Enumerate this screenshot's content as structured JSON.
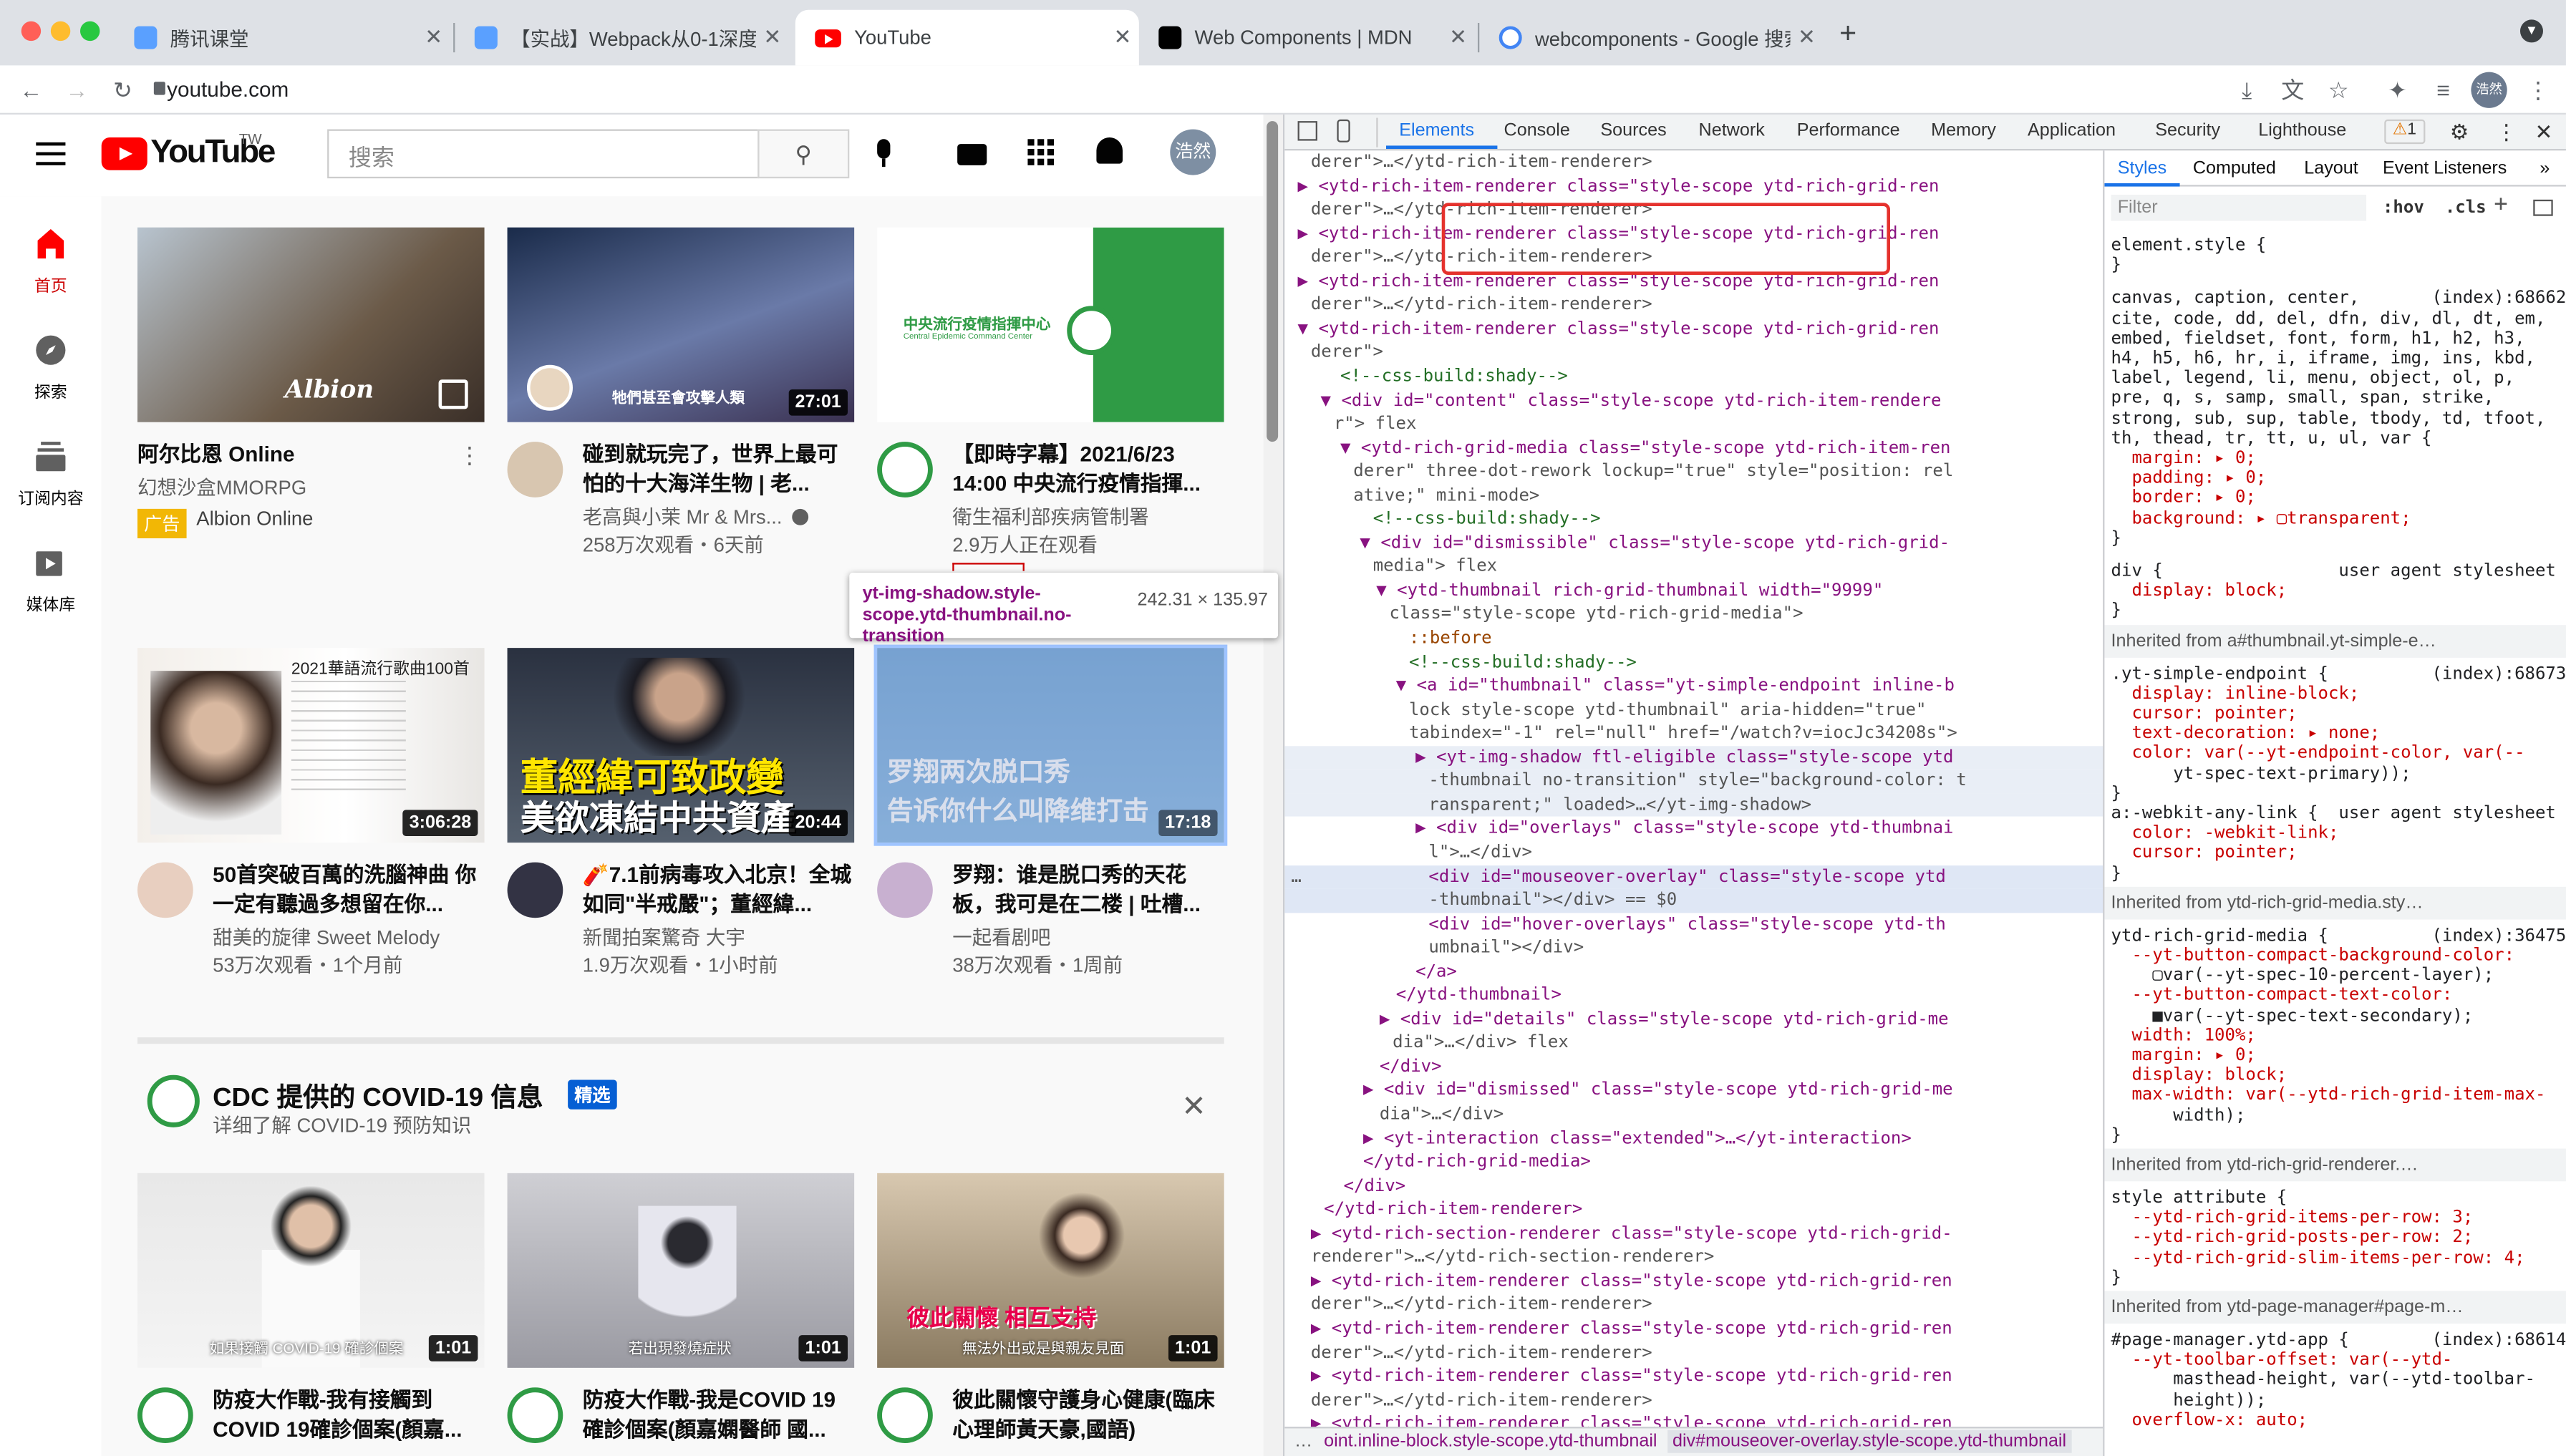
{
  "browser": {
    "tabs": [
      {
        "title": "腾讯课堂"
      },
      {
        "title": "【实战】Webpack从0-1深度细化"
      },
      {
        "title": "YouTube"
      },
      {
        "title": "Web Components | MDN"
      },
      {
        "title": "webcomponents - Google 搜索"
      }
    ],
    "url": "youtube.com",
    "profile": "浩然"
  },
  "yt": {
    "logo": "YouTube",
    "region": "TW",
    "search_placeholder": "搜索",
    "avatar": "浩然",
    "guide": [
      {
        "label": "首页"
      },
      {
        "label": "探索"
      },
      {
        "label": "订阅内容"
      },
      {
        "label": "媒体库"
      }
    ],
    "videos": [
      {
        "title": "阿尔比恩 Online",
        "channel": "幻想沙盒MMORPG",
        "ad_badge": "广告",
        "advertiser": "Albion Online",
        "thumb_text": "Albion"
      },
      {
        "title": "碰到就玩完了，世界上最可怕的十大海洋生物 | 老...",
        "channel": "老高與小茉 Mr & Mrs...",
        "meta": "258万次观看・6天前",
        "duration": "27:01",
        "thumb_text": "牠們甚至會攻擊人類"
      },
      {
        "title": "【即時字幕】2021/6/23 14:00 中央流行疫情指揮...",
        "channel": "衛生福利部疾病管制署",
        "meta": "2.9万人正在观看",
        "thumb_text": "中央流行疫情指揮中心",
        "thumb_sub": "Central Epidemic Command Center"
      },
      {
        "title": "50首突破百萬的洗腦神曲 你一定有聽過多想留在你...",
        "channel": "甜美的旋律 Sweet Melody",
        "meta": "53万次观看・1个月前",
        "duration": "3:06:28",
        "thumb_text": "2021華語流行歌曲100首"
      },
      {
        "title": "🧨7.1前病毒攻入北京！全城如同\"半戒嚴\"；董經緯...",
        "channel": "新聞拍案驚奇 大宇",
        "meta": "1.9万次观看・1小时前",
        "duration": "20:44",
        "thumb_text": "董經緯可致政變",
        "thumb_text2": "美欲凍結中共資產"
      },
      {
        "title": "罗翔：谁是脱口秀的天花板，我可是在二楼 | 吐槽...",
        "channel": "一起看剧吧",
        "meta": "38万次观看・1周前",
        "duration": "17:18",
        "thumb_text": "罗翔两次脱口秀",
        "thumb_text2": "告诉你什么叫降维打击"
      }
    ],
    "shelf": {
      "title": "CDC 提供的 COVID-19 信息",
      "badge": "精选",
      "subtitle": "详细了解 COVID-19 预防知识",
      "videos": [
        {
          "title": "防疫大作戰-我有接觸到COVID 19確診個案(顏嘉...",
          "duration": "1:01",
          "thumb_text": "如果接觸 COVID-19 確診個案"
        },
        {
          "title": "防疫大作戰-我是COVID 19確診個案(顏嘉嫻醫師 國...",
          "duration": "1:01",
          "thumb_text": "若出現發燒症狀"
        },
        {
          "title": "彼此關懷守護身心健康(臨床心理師黃天豪,國語)",
          "duration": "1:01",
          "thumb_text": "彼此關懷 相互支持",
          "thumb_sub": "無法外出或是與親友見面"
        }
      ]
    }
  },
  "devtools": {
    "tabs": [
      "Elements",
      "Console",
      "Sources",
      "Network",
      "Performance",
      "Memory",
      "Application",
      "Security",
      "Lighthouse"
    ],
    "warn_count": "1",
    "tooltip": {
      "selector": "yt-img-shadow.style-scope.ytd-thumbnail.no-transition",
      "size": "242.31 × 135.97"
    },
    "style_tabs": [
      "Styles",
      "Computed",
      "Layout",
      "Event Listeners"
    ],
    "filter_placeholder": "Filter",
    "hov": ":hov",
    "cls": ".cls",
    "breadcrumb": [
      "oint.inline-block.style-scope.ytd-thumbnail",
      "div#mouseover-overlay.style-scope.ytd-thumbnail"
    ]
  }
}
